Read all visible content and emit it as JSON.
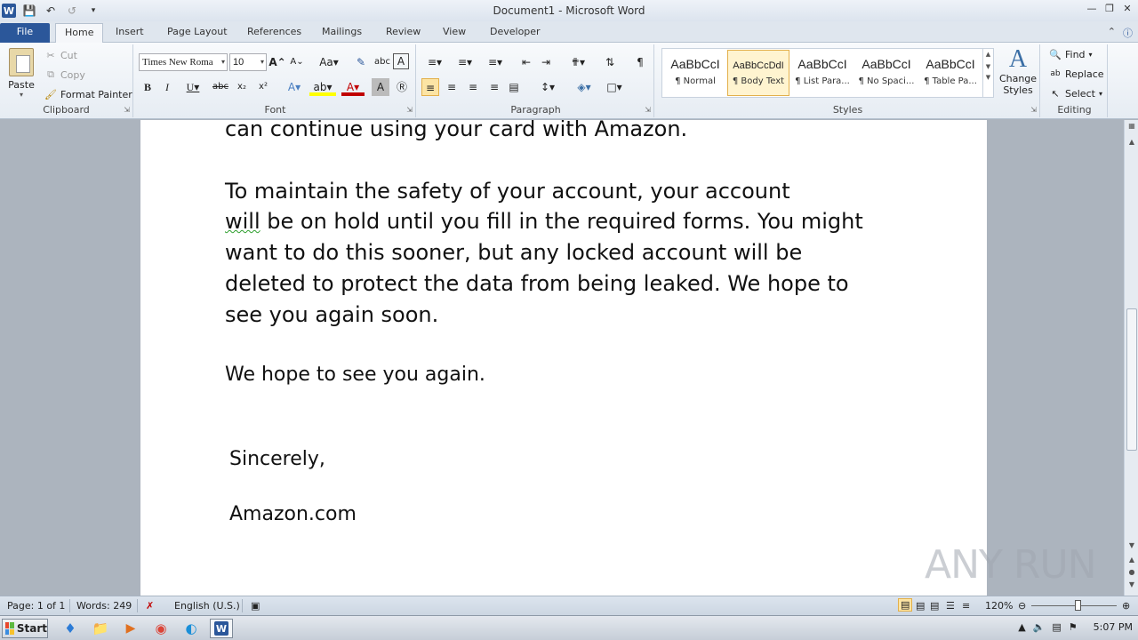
{
  "window": {
    "title": "Document1 - Microsoft Word",
    "qat_icons": [
      "word-logo",
      "save-icon",
      "undo-icon",
      "redo-icon",
      "customize-qat-icon"
    ],
    "controls": [
      "minimize",
      "maximize",
      "close"
    ]
  },
  "tabs": {
    "file": "File",
    "home": "Home",
    "insert": "Insert",
    "page_layout": "Page Layout",
    "references": "References",
    "mailings": "Mailings",
    "review": "Review",
    "view": "View",
    "developer": "Developer"
  },
  "ribbon": {
    "clipboard": {
      "label": "Clipboard",
      "paste": "Paste",
      "cut": "Cut",
      "copy": "Copy",
      "format_painter": "Format Painter"
    },
    "font": {
      "label": "Font",
      "family": "Times New Roma",
      "size": "10"
    },
    "paragraph": {
      "label": "Paragraph"
    },
    "styles": {
      "label": "Styles",
      "items": [
        {
          "sample": "AaBbCcI",
          "name": "¶ Normal"
        },
        {
          "sample": "AaBbCcDdI",
          "name": "¶ Body Text"
        },
        {
          "sample": "AaBbCcI",
          "name": "¶ List Para..."
        },
        {
          "sample": "AaBbCcI",
          "name": "¶ No Spaci..."
        },
        {
          "sample": "AaBbCcI",
          "name": "¶ Table Pa..."
        }
      ],
      "change_styles_line1": "Change",
      "change_styles_line2": "Styles"
    },
    "editing": {
      "label": "Editing",
      "find": "Find",
      "replace": "Replace",
      "select": "Select"
    }
  },
  "document": {
    "lines": [
      "can continue using your card with Amazon.",
      "To maintain the safety of your account, your account",
      "will",
      " be on hold until you fill in the required forms. You might",
      "want to do this sooner, but any locked account will be",
      "deleted to protect the data from being leaked. We hope to",
      "see you again soon.",
      "We hope to see you again.",
      "Sincerely,",
      "Amazon.com"
    ]
  },
  "statusbar": {
    "page": "Page: 1 of 1",
    "words": "Words: 249",
    "language": "English (U.S.)",
    "zoom": "120%"
  },
  "taskbar": {
    "start": "Start",
    "clock": "5:07 PM"
  },
  "watermark": "ANY RUN"
}
